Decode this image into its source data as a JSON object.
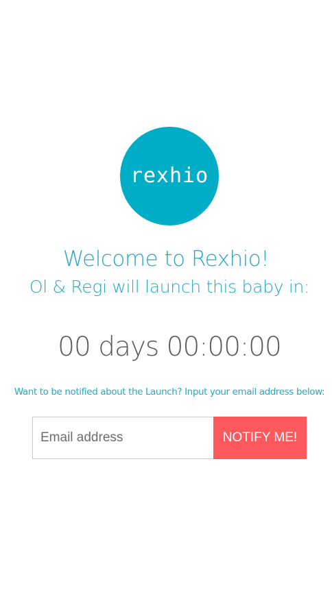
{
  "logo": {
    "text": "rexhio",
    "color": "#00adc7"
  },
  "heading": {
    "title": "Welcome to Rexhio!",
    "subtitle": "Ol & Regi will launch this baby in:"
  },
  "countdown": {
    "text": "00 days 00:00:00"
  },
  "notify": {
    "prompt": "Want to be notified about the Launch? Input your email address below:",
    "email_placeholder": "Email address",
    "email_value": "",
    "button_label": "NOTIFY ME!",
    "button_color": "#fd585c"
  },
  "colors": {
    "accent": "#24a8c5",
    "countdown_text": "#5a5a5a"
  }
}
